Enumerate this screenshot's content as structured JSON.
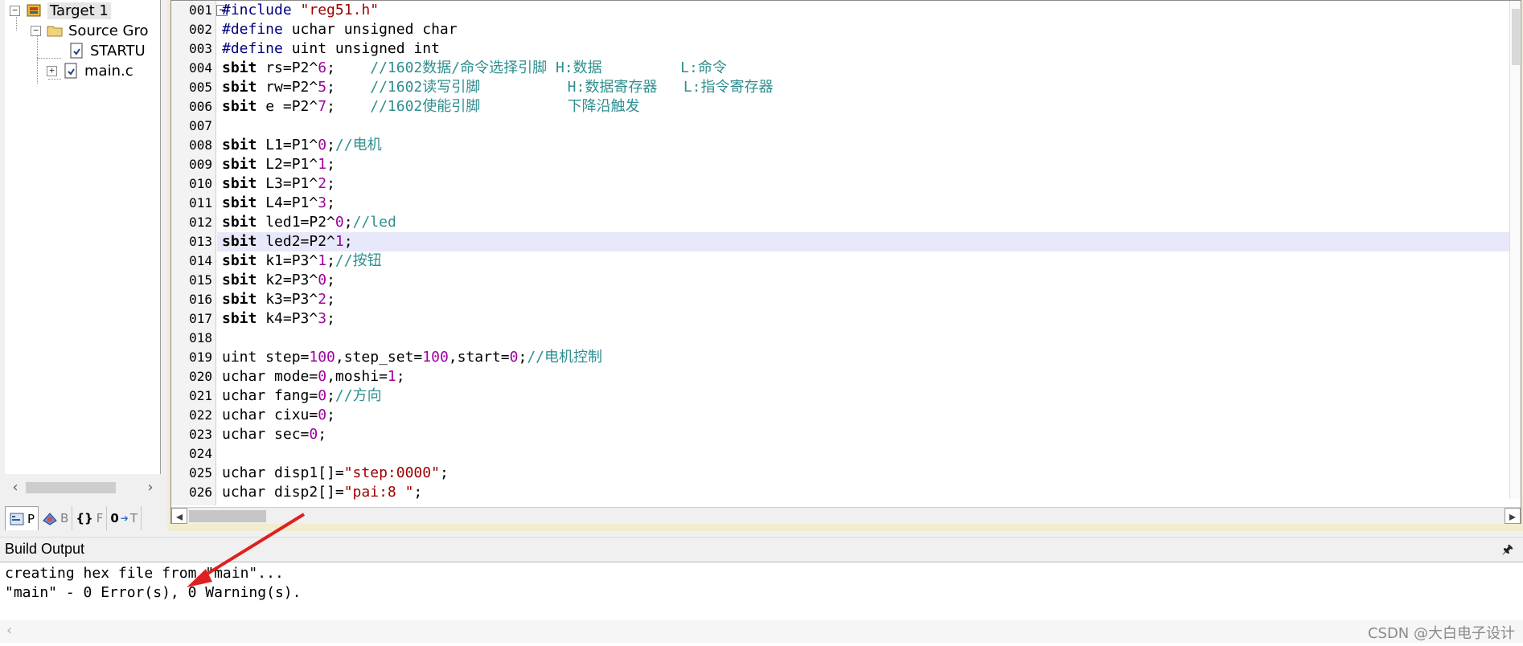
{
  "project_tree": {
    "items": [
      {
        "label": "Target 1",
        "expander": "−",
        "icon": "target-icon"
      },
      {
        "label": "Source Gro",
        "expander": "−",
        "icon": "folder-icon"
      },
      {
        "label": "STARTU",
        "expander": "",
        "icon": "file-icon"
      },
      {
        "label": "main.c",
        "expander": "+",
        "icon": "file-icon"
      }
    ]
  },
  "project_tabs": [
    {
      "label": "P",
      "icon": "project-tab-icon",
      "active": true
    },
    {
      "label": "B",
      "icon": "books-tab-icon",
      "active": false
    },
    {
      "label": "F",
      "icon": "functions-tab-icon",
      "prefix": "{}",
      "active": false
    },
    {
      "label": "T",
      "icon": "templates-tab-icon",
      "prefix": "0",
      "active": false
    }
  ],
  "editor": {
    "highlighted_line": "013",
    "lines": [
      {
        "num": "001",
        "tokens": [
          [
            "pp",
            "#include "
          ],
          [
            "str",
            "\"reg51.h\""
          ]
        ]
      },
      {
        "num": "002",
        "tokens": [
          [
            "pp",
            "#define "
          ],
          [
            "n",
            "uchar unsigned char"
          ]
        ]
      },
      {
        "num": "003",
        "tokens": [
          [
            "pp",
            "#define "
          ],
          [
            "n",
            "uint unsigned int"
          ]
        ]
      },
      {
        "num": "004",
        "tokens": [
          [
            "b",
            "sbit"
          ],
          [
            "n",
            " rs=P2^"
          ],
          [
            "num",
            "6"
          ],
          [
            "n",
            ";    "
          ],
          [
            "cm",
            "//1602数据/命令选择引脚 H:数据         L:命令"
          ]
        ]
      },
      {
        "num": "005",
        "tokens": [
          [
            "b",
            "sbit"
          ],
          [
            "n",
            " rw=P2^"
          ],
          [
            "num",
            "5"
          ],
          [
            "n",
            ";    "
          ],
          [
            "cm",
            "//1602读写引脚          H:数据寄存器   L:指令寄存器"
          ]
        ]
      },
      {
        "num": "006",
        "tokens": [
          [
            "b",
            "sbit"
          ],
          [
            "n",
            " e =P2^"
          ],
          [
            "num",
            "7"
          ],
          [
            "n",
            ";    "
          ],
          [
            "cm",
            "//1602使能引脚          下降沿触发"
          ]
        ]
      },
      {
        "num": "007",
        "tokens": []
      },
      {
        "num": "008",
        "tokens": [
          [
            "b",
            "sbit"
          ],
          [
            "n",
            " L1=P1^"
          ],
          [
            "num",
            "0"
          ],
          [
            "n",
            ";"
          ],
          [
            "cm",
            "//电机"
          ]
        ]
      },
      {
        "num": "009",
        "tokens": [
          [
            "b",
            "sbit"
          ],
          [
            "n",
            " L2=P1^"
          ],
          [
            "num",
            "1"
          ],
          [
            "n",
            ";"
          ]
        ]
      },
      {
        "num": "010",
        "tokens": [
          [
            "b",
            "sbit"
          ],
          [
            "n",
            " L3=P1^"
          ],
          [
            "num",
            "2"
          ],
          [
            "n",
            ";"
          ]
        ]
      },
      {
        "num": "011",
        "tokens": [
          [
            "b",
            "sbit"
          ],
          [
            "n",
            " L4=P1^"
          ],
          [
            "num",
            "3"
          ],
          [
            "n",
            ";"
          ]
        ]
      },
      {
        "num": "012",
        "tokens": [
          [
            "b",
            "sbit"
          ],
          [
            "n",
            " led1=P2^"
          ],
          [
            "num",
            "0"
          ],
          [
            "n",
            ";"
          ],
          [
            "cm",
            "//led"
          ]
        ]
      },
      {
        "num": "013",
        "tokens": [
          [
            "b",
            "sbit"
          ],
          [
            "n",
            " led2=P2^"
          ],
          [
            "num",
            "1"
          ],
          [
            "n",
            ";"
          ]
        ]
      },
      {
        "num": "014",
        "tokens": [
          [
            "b",
            "sbit"
          ],
          [
            "n",
            " k1=P3^"
          ],
          [
            "num",
            "1"
          ],
          [
            "n",
            ";"
          ],
          [
            "cm",
            "//按钮"
          ]
        ]
      },
      {
        "num": "015",
        "tokens": [
          [
            "b",
            "sbit"
          ],
          [
            "n",
            " k2=P3^"
          ],
          [
            "num",
            "0"
          ],
          [
            "n",
            ";"
          ]
        ]
      },
      {
        "num": "016",
        "tokens": [
          [
            "b",
            "sbit"
          ],
          [
            "n",
            " k3=P3^"
          ],
          [
            "num",
            "2"
          ],
          [
            "n",
            ";"
          ]
        ]
      },
      {
        "num": "017",
        "tokens": [
          [
            "b",
            "sbit"
          ],
          [
            "n",
            " k4=P3^"
          ],
          [
            "num",
            "3"
          ],
          [
            "n",
            ";"
          ]
        ]
      },
      {
        "num": "018",
        "tokens": []
      },
      {
        "num": "019",
        "tokens": [
          [
            "n",
            "uint step="
          ],
          [
            "num",
            "100"
          ],
          [
            "n",
            ",step_set="
          ],
          [
            "num",
            "100"
          ],
          [
            "n",
            ",start="
          ],
          [
            "num",
            "0"
          ],
          [
            "n",
            ";"
          ],
          [
            "cm",
            "//电机控制"
          ]
        ]
      },
      {
        "num": "020",
        "tokens": [
          [
            "n",
            "uchar mode="
          ],
          [
            "num",
            "0"
          ],
          [
            "n",
            ",moshi="
          ],
          [
            "num",
            "1"
          ],
          [
            "n",
            ";"
          ]
        ]
      },
      {
        "num": "021",
        "tokens": [
          [
            "n",
            "uchar fang="
          ],
          [
            "num",
            "0"
          ],
          [
            "n",
            ";"
          ],
          [
            "cm",
            "//方向"
          ]
        ]
      },
      {
        "num": "022",
        "tokens": [
          [
            "n",
            "uchar cixu="
          ],
          [
            "num",
            "0"
          ],
          [
            "n",
            ";"
          ]
        ]
      },
      {
        "num": "023",
        "tokens": [
          [
            "n",
            "uchar sec="
          ],
          [
            "num",
            "0"
          ],
          [
            "n",
            ";"
          ]
        ]
      },
      {
        "num": "024",
        "tokens": []
      },
      {
        "num": "025",
        "tokens": [
          [
            "n",
            "uchar disp1[]="
          ],
          [
            "str",
            "\"step:0000\""
          ],
          [
            "n",
            ";"
          ]
        ]
      },
      {
        "num": "026",
        "tokens": [
          [
            "n",
            "uchar disp2[]="
          ],
          [
            "str",
            "\"pai:8 \""
          ],
          [
            "n",
            ";"
          ]
        ]
      }
    ]
  },
  "build_output": {
    "title": "Build Output",
    "lines": [
      "creating hex file from \"main\"...",
      "\"main\" - 0 Error(s), 0 Warning(s)."
    ]
  },
  "watermark": "CSDN @大白电子设计",
  "colors": {
    "annotation_arrow": "#e02020",
    "comment": "#2f8f8f",
    "number": "#a000a0",
    "string": "#a00000",
    "highlight": "#e8e8fb"
  }
}
